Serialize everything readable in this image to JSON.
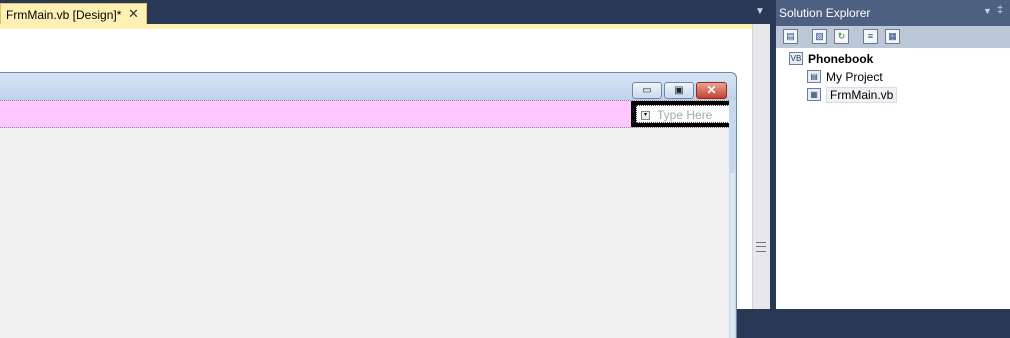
{
  "document": {
    "tab_title": "FrmMain.vb [Design]*",
    "tab_close": "✕",
    "tab_dropdown": "▼"
  },
  "form_designer": {
    "minimize": "▭",
    "maximize": "▣",
    "close": "✕",
    "menu_placeholder": "Type Here",
    "menu_arrow": "▾"
  },
  "solution_explorer": {
    "title": "Solution Explorer",
    "dropdown": "▼",
    "pin": "‡",
    "toolbar": [
      "properties-icon",
      "show-all-files-icon",
      "refresh-icon",
      "view-code-icon",
      "view-designer-icon"
    ],
    "tree": {
      "root": "Phonebook",
      "items": [
        "My Project",
        "FrmMain.vb"
      ]
    }
  },
  "colors": {
    "ide_background": "#293955",
    "active_tab": "#fff1b4",
    "menu_strip": "#ffc6ff",
    "panel_title": "#4d6082",
    "form_body": "#f0f0f0"
  }
}
